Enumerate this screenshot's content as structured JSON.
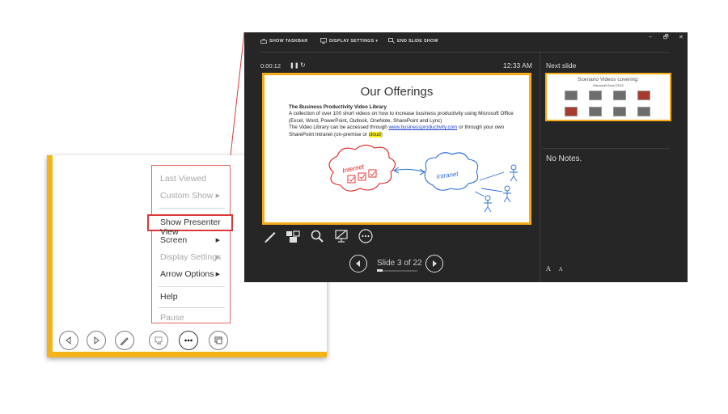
{
  "context_menu": {
    "items": [
      {
        "label": "Last Viewed",
        "enabled": false,
        "submenu": false
      },
      {
        "label": "Custom Show",
        "enabled": false,
        "submenu": true
      },
      {
        "label": "Show Presenter View",
        "enabled": true,
        "submenu": false,
        "highlighted": true
      },
      {
        "label": "Screen",
        "enabled": true,
        "submenu": true
      },
      {
        "label": "Display Settings",
        "enabled": false,
        "submenu": true
      },
      {
        "label": "Arrow Options",
        "enabled": true,
        "submenu": true
      },
      {
        "label": "Help",
        "enabled": true,
        "submenu": false
      },
      {
        "label": "Pause",
        "enabled": false,
        "submenu": false
      }
    ]
  },
  "slideshow_controls": [
    "previous-icon",
    "next-icon",
    "pen-icon",
    "see-all-slides-icon",
    "more-options-icon",
    "presenter-view-icon"
  ],
  "presenter_view": {
    "taskbar": {
      "show_taskbar": "SHOW TASKBAR",
      "display_settings": "DISPLAY SETTINGS ▾",
      "end_slide_show": "END SLIDE SHOW"
    },
    "window_controls": [
      "–",
      "🗗",
      "✕"
    ],
    "timer": "0:00:12",
    "clock": "12:33 AM",
    "next_slide_label": "Next slide",
    "notes": "No Notes.",
    "slide_counter": "Slide 3 of 22",
    "progress_fraction": 0.136,
    "font_buttons": [
      "A",
      "A"
    ]
  },
  "current_slide": {
    "title": "Our Offerings",
    "subtitle": "The Business Productivity Video Library",
    "line1": "A collection of over 100 short videos on how to increase business productivity using Microsoft Office",
    "line2": "(Excel, Word, PowerPoint, Outlook, OneNote, SharePoint and Lync)",
    "line3_pre": "The Video Library can be accessed through ",
    "line3_link": "www.businessproductivity.com",
    "line3_post": " or through your own",
    "line4_pre": "SharePoint Intranet (on-premise or ",
    "line4_highlight": "cloud",
    "line4_post": ")",
    "ink_internet": "Internet",
    "ink_intranet": "Intranet"
  },
  "next_slide": {
    "title": "Scenario Videos covering:",
    "subtitle": "Microsoft Excel 2013"
  },
  "colors": {
    "accent_orange": "#f5ac1b",
    "highlight_red": "#d9393a",
    "presenter_bg": "#262626",
    "ink_red": "#e02020",
    "ink_blue": "#2a6fd6"
  }
}
